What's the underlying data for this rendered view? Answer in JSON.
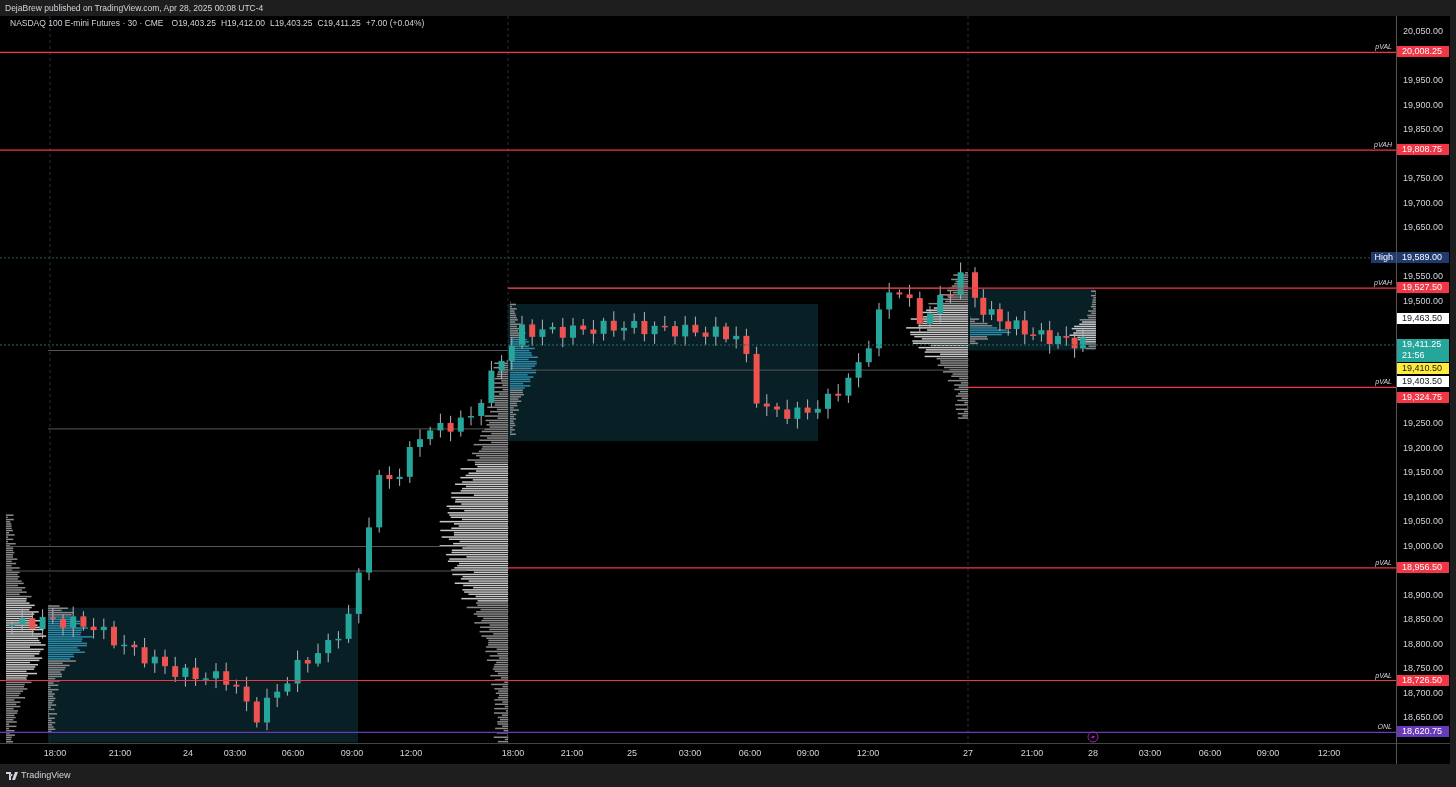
{
  "header": {
    "text": "DejaBrew published on TradingView.com, Apr 28, 2025 00:08 UTC-4"
  },
  "legend": {
    "symbol": "NASDAQ 100 E-mini Futures · 30 · CME",
    "values": [
      "O19,403.25",
      "H19,412.00",
      "L19,403.25",
      "C19,411.25",
      "+7.00 (+0.04%)"
    ]
  },
  "levels": [
    {
      "label": "pVAL",
      "price": "20,008.25",
      "color": "#f23645"
    },
    {
      "label": "pVAH",
      "price": "19,808.75",
      "color": "#f23645"
    },
    {
      "label": "pVAH",
      "price": "19,527.50",
      "color": "#f23645"
    },
    {
      "label": "pVAL",
      "price": "19,324.75",
      "color": "#f23645"
    },
    {
      "label": "pVAL",
      "price": "18,956.50",
      "color": "#f23645"
    },
    {
      "label": "pVAL",
      "price": "18,726.50",
      "color": "#f23645"
    },
    {
      "label": "ONL",
      "price": "18,620.75",
      "color": "#673ab7"
    }
  ],
  "price_axis": {
    "ticks": [
      "20,050.00",
      "19,950.00",
      "19,900.00",
      "19,850.00",
      "19,750.00",
      "19,700.00",
      "19,650.00",
      "19,550.00",
      "19,500.00",
      "19,250.00",
      "19,200.00",
      "19,150.00",
      "19,100.00",
      "19,050.00",
      "19,000.00",
      "18,900.00",
      "18,850.00",
      "18,800.00",
      "18,750.00",
      "18,700.00",
      "18,650.00"
    ],
    "markers": [
      {
        "kind": "high",
        "label": "High",
        "price": "19,589.00",
        "color": "#1e3a6e"
      },
      {
        "kind": "price",
        "price": "19,463.50",
        "color": "#ffffff"
      },
      {
        "kind": "last",
        "price": "19,411.25",
        "countdown": "21:56",
        "color": "#26a69a"
      },
      {
        "kind": "price",
        "price": "19,410.50",
        "color": "#ffeb3b"
      },
      {
        "kind": "price",
        "price": "19,403.50",
        "color": "#ffffff"
      }
    ]
  },
  "time_axis": [
    "18:00",
    "21:00",
    "24",
    "03:00",
    "06:00",
    "09:00",
    "12:00",
    "18:00",
    "21:00",
    "25",
    "03:00",
    "06:00",
    "09:00",
    "12:00",
    "27",
    "21:00",
    "28",
    "03:00",
    "06:00",
    "09:00",
    "12:00"
  ],
  "footer": {
    "logo": "TradingView"
  }
}
